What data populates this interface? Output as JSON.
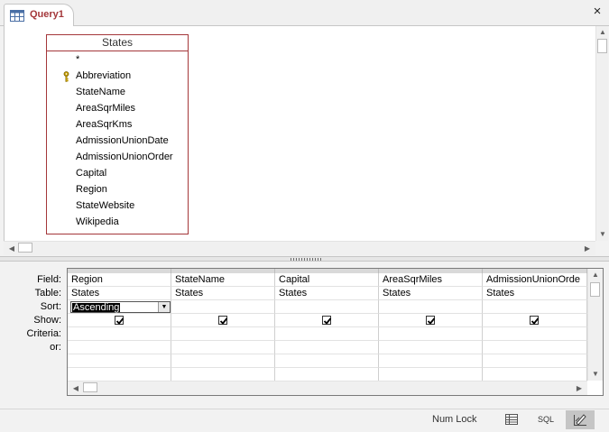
{
  "tab": {
    "title": "Query1",
    "close_symbol": "×"
  },
  "table": {
    "name": "States",
    "fields": [
      "*",
      "Abbreviation",
      "StateName",
      "AreaSqrMiles",
      "AreaSqrKms",
      "AdmissionUnionDate",
      "AdmissionUnionOrder",
      "Capital",
      "Region",
      "StateWebsite",
      "Wikipedia"
    ],
    "primary_key_field": "Abbreviation"
  },
  "grid": {
    "row_labels": [
      "Field:",
      "Table:",
      "Sort:",
      "Show:",
      "Criteria:",
      "or:"
    ],
    "columns": [
      {
        "field": "Region",
        "table": "States",
        "sort": "Ascending",
        "show": true
      },
      {
        "field": "StateName",
        "table": "States",
        "sort": "",
        "show": true
      },
      {
        "field": "Capital",
        "table": "States",
        "sort": "",
        "show": true
      },
      {
        "field": "AreaSqrMiles",
        "table": "States",
        "sort": "",
        "show": true
      },
      {
        "field": "AdmissionUnionOrde",
        "table": "States",
        "sort": "",
        "show": true
      }
    ]
  },
  "status": {
    "num_lock": "Num Lock",
    "sql_label": "SQL"
  },
  "colors": {
    "accent": "#a4373a"
  }
}
